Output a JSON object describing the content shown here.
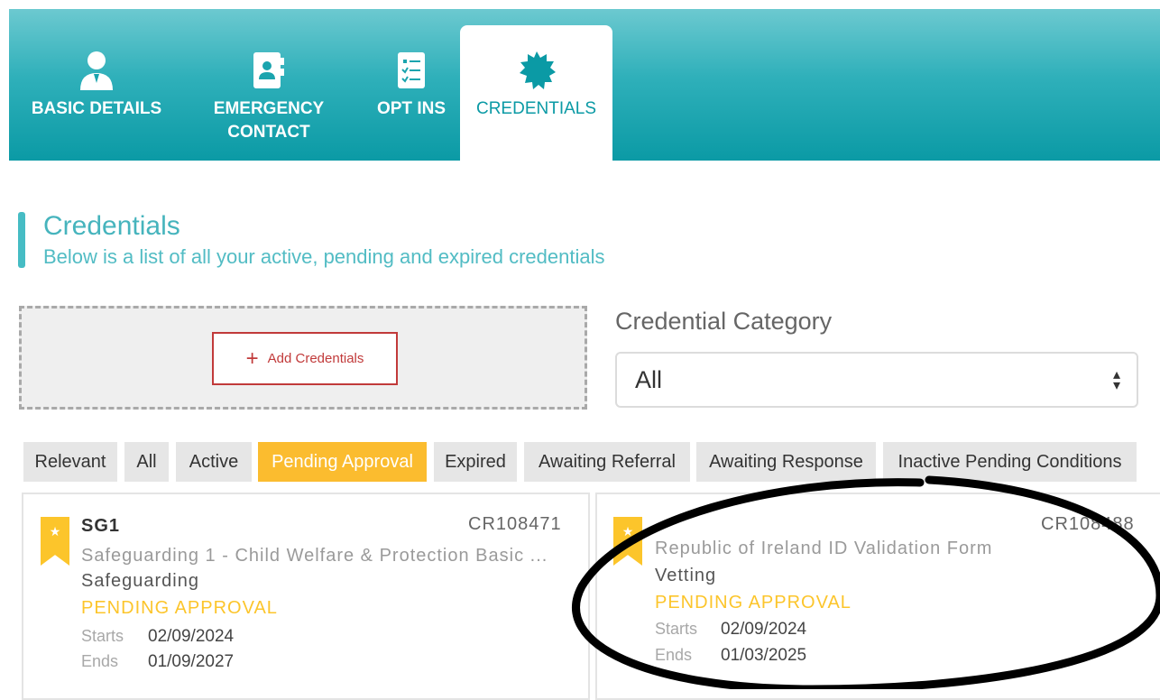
{
  "tabs": [
    {
      "label_line1": "BASIC DETAILS",
      "label_line2": "",
      "icon": "user-icon",
      "active": false
    },
    {
      "label_line1": "EMERGENCY",
      "label_line2": "CONTACT",
      "icon": "contact-book-icon",
      "active": false
    },
    {
      "label_line1": "OPT INS",
      "label_line2": "",
      "icon": "checklist-icon",
      "active": false
    },
    {
      "label_line1": "CREDENTIALS",
      "label_line2": "",
      "icon": "badge-icon",
      "active": true
    }
  ],
  "header": {
    "title": "Credentials",
    "subtitle": "Below is a list of all your active, pending and expired credentials"
  },
  "add_button": {
    "icon": "plus-icon",
    "label": "Add Credentials"
  },
  "category": {
    "label": "Credential Category",
    "selected": "All"
  },
  "filters": [
    "Relevant",
    "All",
    "Active",
    "Pending Approval",
    "Expired",
    "Awaiting Referral",
    "Awaiting Response",
    "Inactive Pending Conditions"
  ],
  "active_filter": "Pending Approval",
  "cards": [
    {
      "code": "SG1",
      "id": "CR108471",
      "name": "Safeguarding 1 - Child Welfare & Protection Basic ...",
      "category": "Safeguarding",
      "status": "PENDING APPROVAL",
      "starts_label": "Starts",
      "starts": "02/09/2024",
      "ends_label": "Ends",
      "ends": "01/09/2027"
    },
    {
      "code": "",
      "id": "CR108488",
      "name": "Republic of Ireland ID Validation Form",
      "category": "Vetting",
      "status": "PENDING APPROVAL",
      "starts_label": "Starts",
      "starts": "02/09/2024",
      "ends_label": "Ends",
      "ends": "01/03/2025"
    }
  ],
  "colors": {
    "teal": "#0b9aa5",
    "teal_text": "#46b4bd",
    "pending": "#fcc52b",
    "add_red": "#c13a3a"
  }
}
